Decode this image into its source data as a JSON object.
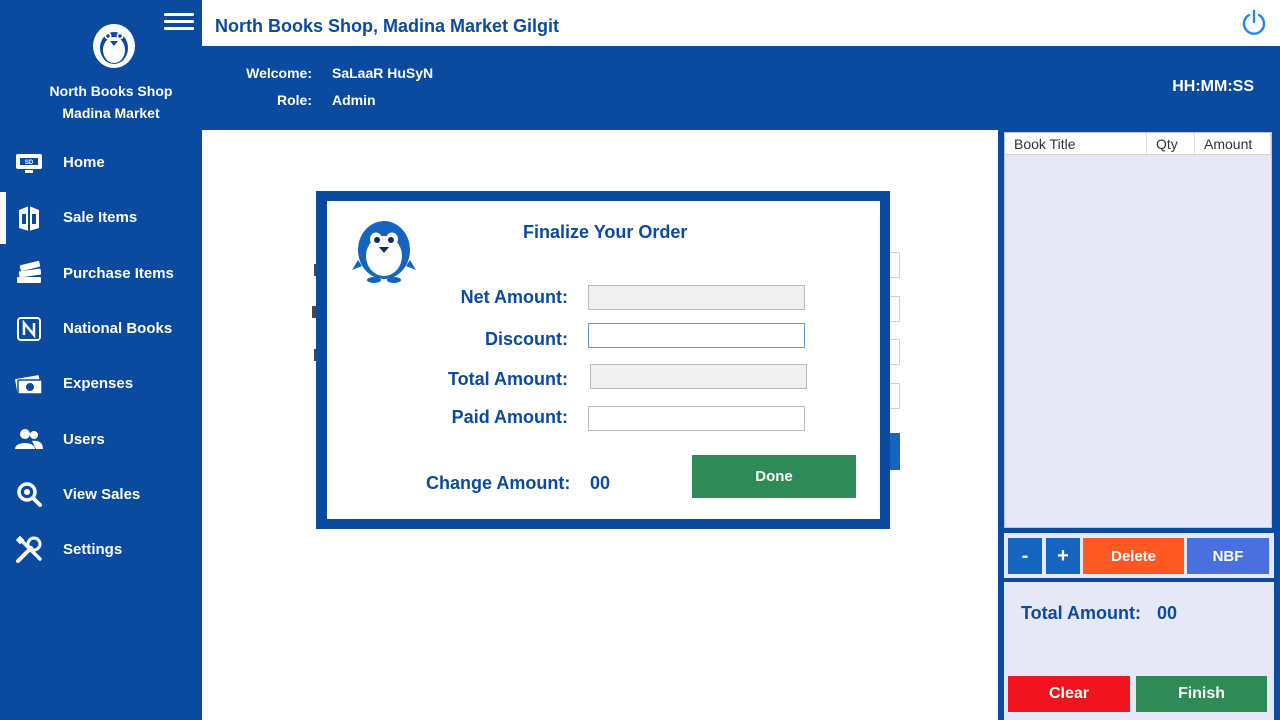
{
  "app": {
    "title": "North Books Shop, Madina Market Gilgit",
    "brand_line1": "North Books Shop",
    "brand_line2": "Madina Market"
  },
  "user": {
    "welcome_label": "Welcome:",
    "welcome_value": "SaLaaR HuSyN",
    "role_label": "Role:",
    "role_value": "Admin",
    "clock": "HH:MM:SS"
  },
  "sidebar": {
    "items": [
      {
        "label": "Home",
        "icon": "home-icon"
      },
      {
        "label": "Sale Items",
        "icon": "sale-items-icon"
      },
      {
        "label": "Purchase Items",
        "icon": "books-stack-icon"
      },
      {
        "label": "National Books",
        "icon": "n-logo-icon"
      },
      {
        "label": "Expenses",
        "icon": "money-icon"
      },
      {
        "label": "Users",
        "icon": "users-icon"
      },
      {
        "label": "View Sales",
        "icon": "magnifier-icon"
      },
      {
        "label": "Settings",
        "icon": "tools-icon"
      }
    ]
  },
  "modal": {
    "title": "Finalize Your Order",
    "net_amount_label": "Net Amount:",
    "discount_label": "Discount:",
    "total_amount_label": "Total Amount:",
    "paid_amount_label": "Paid Amount:",
    "change_amount_label": "Change Amount:",
    "change_amount_value": "00",
    "done_label": "Done"
  },
  "cart": {
    "columns": [
      "Book Title",
      "Qty",
      "Amount"
    ],
    "minus_label": "-",
    "plus_label": "+",
    "delete_label": "Delete",
    "nbf_label": "NBF",
    "total_label": "Total Amount:",
    "total_value": "00",
    "clear_label": "Clear",
    "finish_label": "Finish"
  },
  "colors": {
    "primary": "#0a4a9f",
    "done_green": "#2e8b57",
    "delete_orange": "#ff5722",
    "clear_red": "#f0121c",
    "nbf_blue": "#4a6fde",
    "panel_bg": "#e6e8f7"
  }
}
